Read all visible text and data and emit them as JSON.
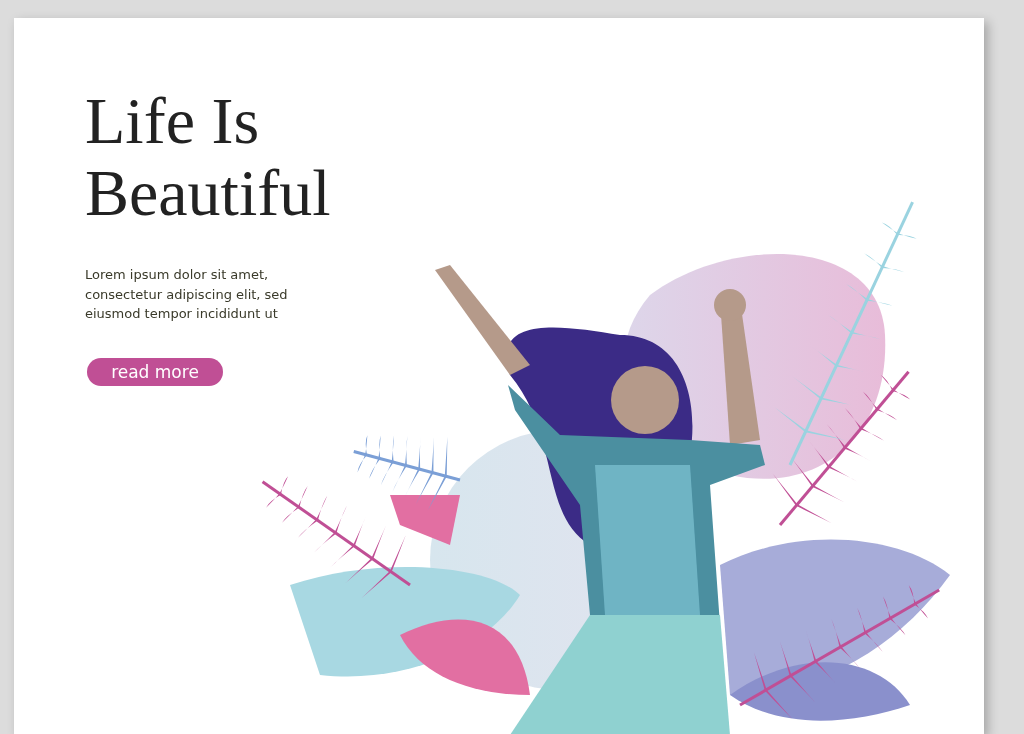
{
  "hero": {
    "title": "Life Is Beautiful",
    "text": "Lorem ipsum dolor sit amet, consectetur adipiscing elit, sed eiusmod tempor incididunt ut",
    "button": "read more"
  }
}
